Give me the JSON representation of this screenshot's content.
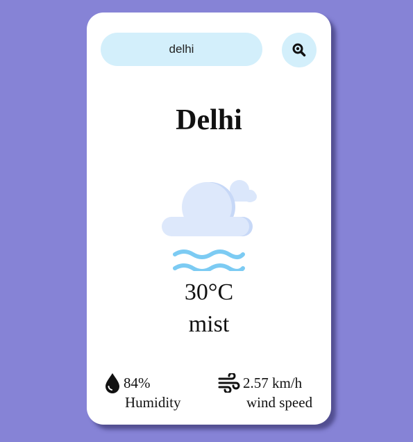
{
  "search": {
    "value": "delhi",
    "icon": "magnifier-icon"
  },
  "weather": {
    "city": "Delhi",
    "icon": "mist-cloud-icon",
    "temperature": "30°C",
    "description": "mist"
  },
  "details": {
    "humidity": {
      "icon": "water-drop-icon",
      "value": "84%",
      "label": "Humidity"
    },
    "wind": {
      "icon": "wind-icon",
      "value": "2.57 km/h",
      "label": "wind speed"
    }
  },
  "colors": {
    "background": "#8683d6",
    "card": "#ffffff",
    "search_bg": "#d3effb",
    "cloud": "#dde8fb",
    "mist_lines": "#7ccbf3"
  }
}
